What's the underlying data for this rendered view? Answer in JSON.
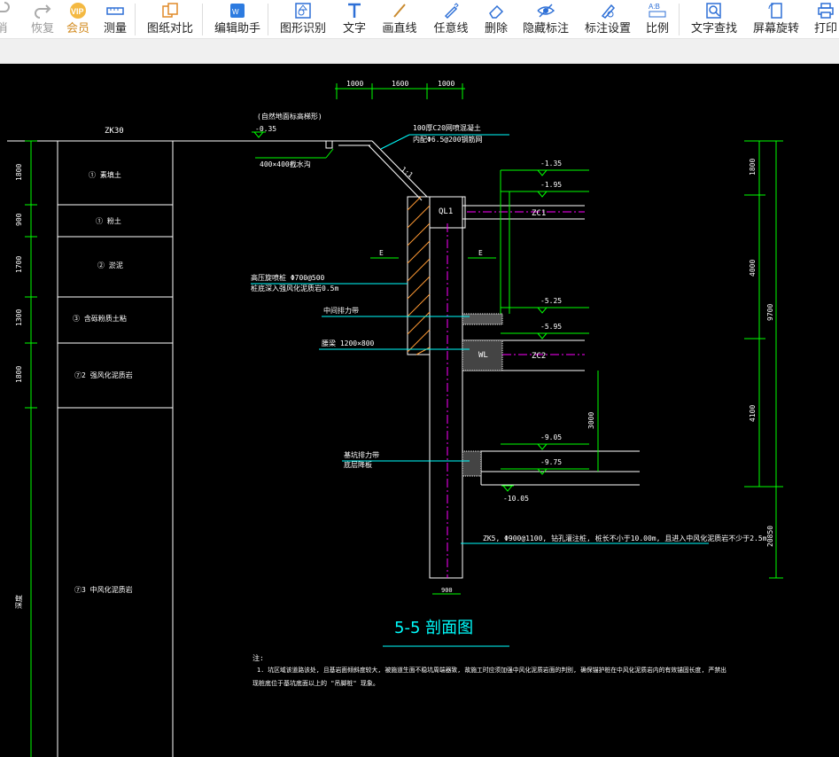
{
  "toolbar": {
    "items": [
      {
        "label": "消",
        "icon": "undo-icon"
      },
      {
        "label": "恢复",
        "icon": "redo-icon"
      },
      {
        "label": "会员",
        "icon": "vip-icon"
      },
      {
        "label": "测量",
        "icon": "ruler-icon"
      },
      {
        "label": "图纸对比",
        "icon": "compare-icon"
      },
      {
        "label": "编辑助手",
        "icon": "edit-assistant-icon"
      },
      {
        "label": "图形识别",
        "icon": "shape-recognition-icon"
      },
      {
        "label": "文字",
        "icon": "text-icon"
      },
      {
        "label": "画直线",
        "icon": "line-icon"
      },
      {
        "label": "任意线",
        "icon": "freehand-icon"
      },
      {
        "label": "删除",
        "icon": "eraser-icon"
      },
      {
        "label": "隐藏标注",
        "icon": "hide-annotation-icon"
      },
      {
        "label": "标注设置",
        "icon": "annotation-settings-icon"
      },
      {
        "label": "比例",
        "icon": "scale-icon"
      },
      {
        "label": "文字查找",
        "icon": "text-search-icon"
      },
      {
        "label": "屏幕旋转",
        "icon": "rotate-screen-icon"
      },
      {
        "label": "打印",
        "icon": "print-icon"
      }
    ]
  },
  "colors": {
    "dim_green": "#00ff00",
    "cyan": "#00ffff",
    "white": "#ffffff",
    "magenta": "#ff00ff",
    "orange": "#ff9933"
  },
  "drawing": {
    "title": "5-5 剖面图",
    "borehole": "ZK30",
    "top_dims": [
      "1000",
      "1600",
      "1000"
    ],
    "layers": [
      {
        "dim": "1800",
        "label": "①  素填土"
      },
      {
        "dim": "900",
        "label": "①  粉土"
      },
      {
        "dim": "1700",
        "label": "②  淤泥"
      },
      {
        "dim": "1300",
        "label": "③  含砾粉质土粘"
      },
      {
        "dim": "1800",
        "label": "⑦2  强风化泥质岩"
      },
      {
        "dim": "深度",
        "label": "⑦3  中风化泥质岩"
      }
    ],
    "notes_top": {
      "ground_note": "(自然地面标高梯形)",
      "ground_elev": "-0.35",
      "drain_ditch": "400×400截水沟",
      "concrete_face": "100厚C20网喷混凝土",
      "mesh": "内配Φ6.5@200钢筋网",
      "slope": "1:1"
    },
    "elevations": {
      "e1": "-1.35",
      "e2": "-1.95",
      "e3": "-5.25",
      "e4": "-5.95",
      "e5": "-9.05",
      "e6": "-9.75",
      "e7": "-10.05"
    },
    "members": {
      "ql1": "QL1",
      "zc1": "ZC1",
      "zc2": "ZC2",
      "wl": "WL",
      "e_left": "E",
      "e_right": "E"
    },
    "callouts": {
      "jet": "高压旋喷桩 Φ700@500",
      "jet2": "桩底深入强风化泥质岩0.5m",
      "pin": "中间排力带",
      "waist": "腰梁 1200×800",
      "bottom_pin": "基坑排力带",
      "bottom_pin2": "底层降板",
      "pile": "ZK5, Φ900@1100, 钻孔灌注桩, 桩长不小于10.00m, 且进入中风化泥质岩不少于2.5m",
      "pile_width": "900",
      "dim_3000": "3000"
    },
    "right_dims": {
      "d1": "1800",
      "d2": "4000",
      "d3": "4100",
      "total": "9700",
      "below": "20850"
    },
    "note_head": "注:",
    "note_line1": "1. 坑区域该道路该处, 且基岩面倾斜度较大, 被施道生面不稳坑周端器致, 故施工时应须加强中风化泥质岩面的判别, 确保锚护桩在中风化泥质岩内的有效锚固长度, 严禁出",
    "note_line2": "现桩底位于基坑底面以上的 \"吊脚桩\" 现象。"
  }
}
